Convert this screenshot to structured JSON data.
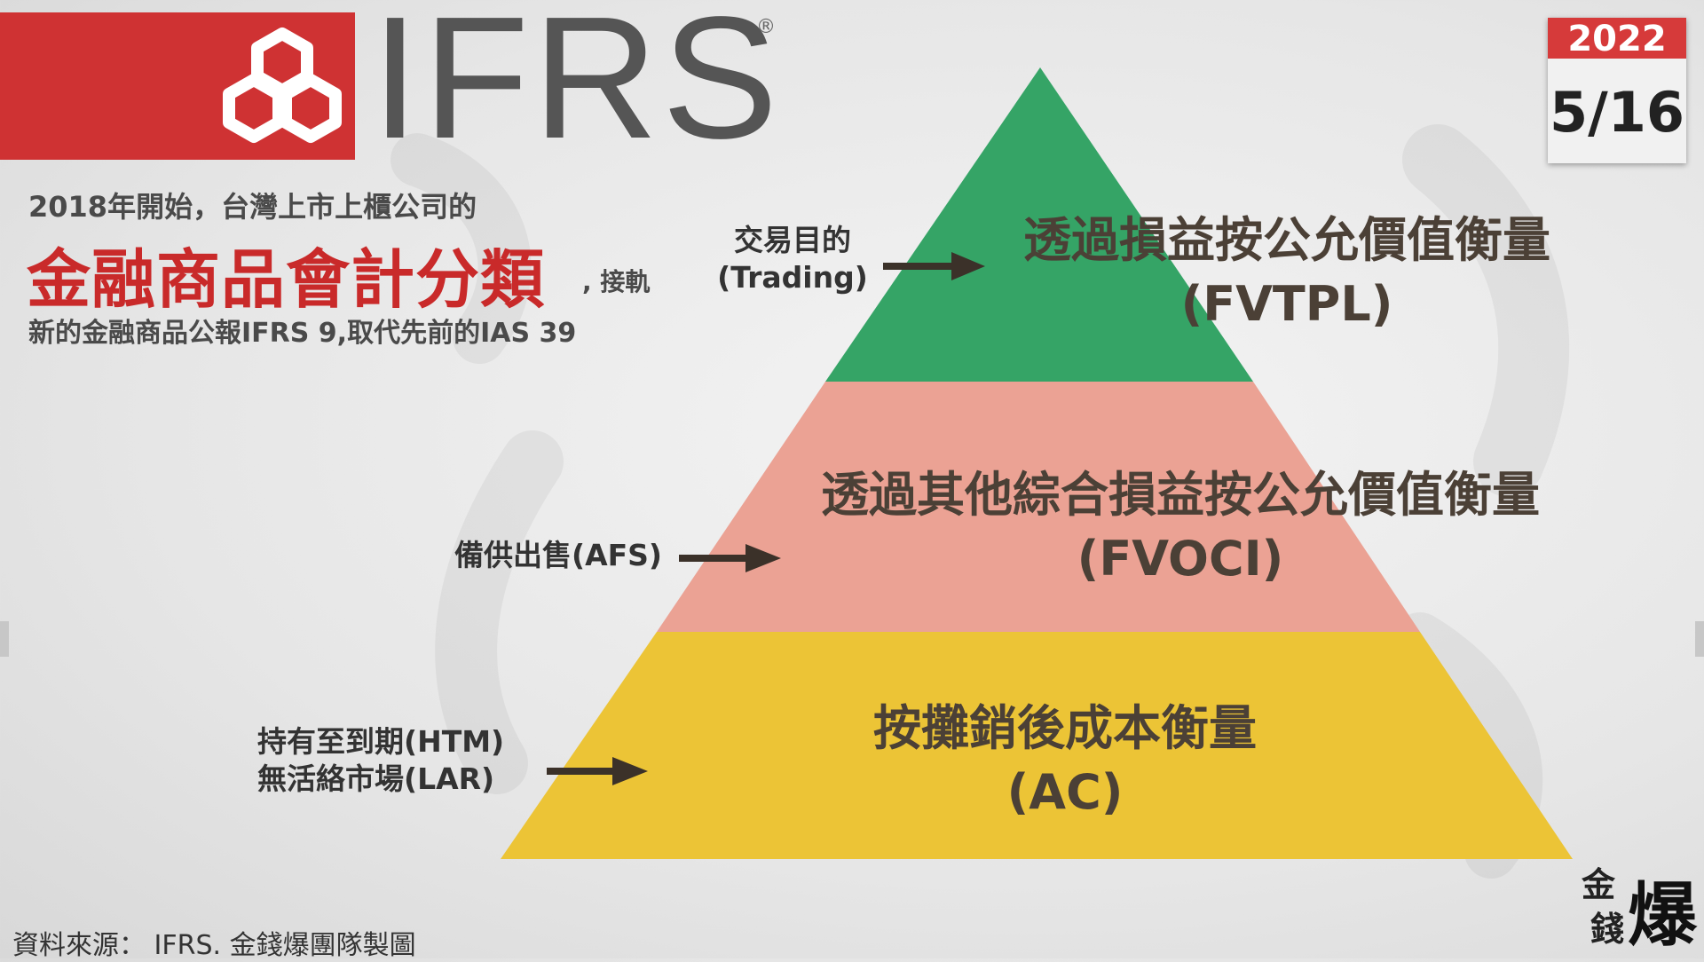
{
  "header": {
    "logo_text": "IFRS",
    "registered_mark": "®"
  },
  "intro": {
    "line1": "2018年開始，台灣上市上櫃公司的",
    "title": "金融商品會計分類",
    "title_tail": ", 接軌",
    "line2": "新的金融商品公報IFRS 9,取代先前的IAS 39"
  },
  "date": {
    "year": "2022",
    "day": "5/16"
  },
  "pyramid": {
    "tiers": [
      {
        "name_zh": "透過損益按公允價值衡量",
        "abbr": "(FVTPL)",
        "color": "#35a466",
        "source_label_1": "交易目的",
        "source_label_2": "(Trading)"
      },
      {
        "name_zh": "透過其他綜合損益按公允價值衡量",
        "abbr": "(FVOCI)",
        "color": "#eba294",
        "source_label_1": "備供出售(AFS)"
      },
      {
        "name_zh": "按攤銷後成本衡量",
        "abbr": "(AC)",
        "color": "#ecc436",
        "source_label_1": "持有至到期(HTM)",
        "source_label_2": "無活絡市場(LAR)"
      }
    ]
  },
  "footer": {
    "source": "資料來源： IFRS. 金錢爆團隊製圖",
    "brand_1": "金",
    "brand_2": "錢",
    "brand_3": "爆"
  },
  "colors": {
    "brand_red": "#cf3233",
    "text_dark": "#4b4036"
  }
}
